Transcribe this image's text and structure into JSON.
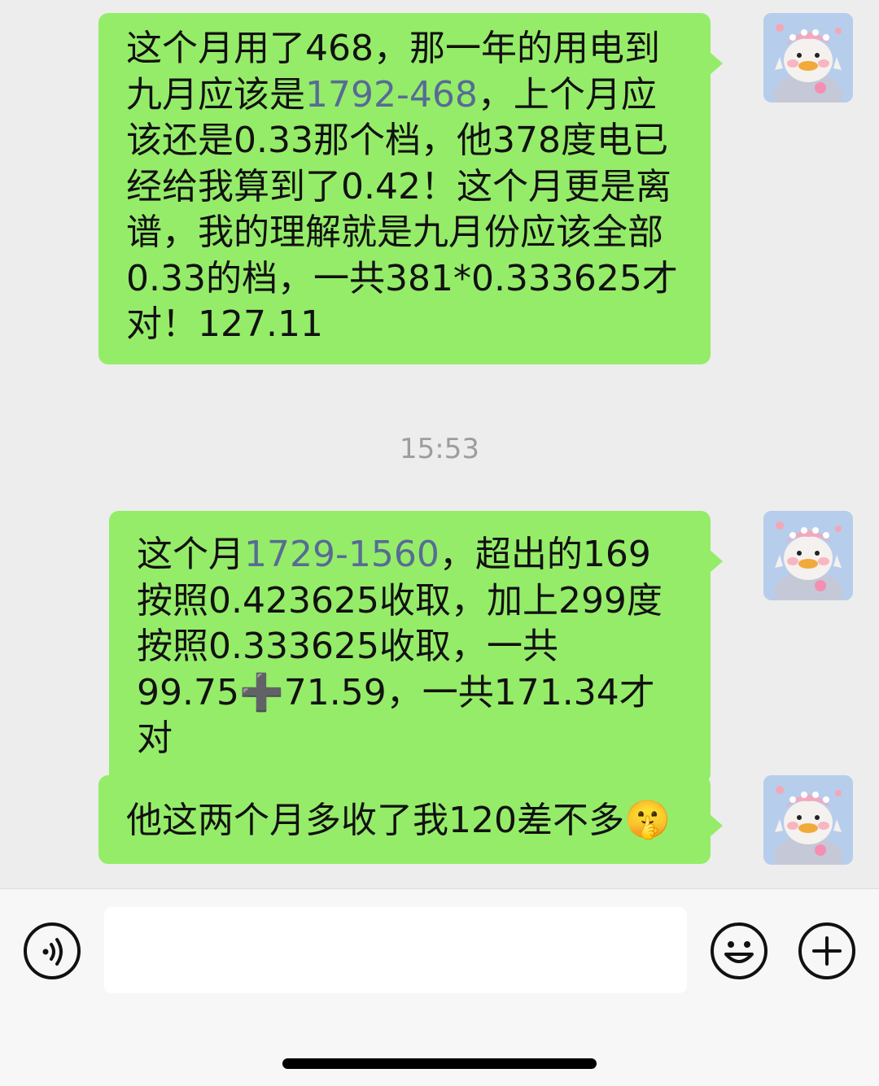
{
  "messages": [
    {
      "sender": "me",
      "parts": [
        {
          "text": "这个月用了468，那一年的用电到九月应该是"
        },
        {
          "text": "1792-468",
          "link": true
        },
        {
          "text": "，上个月应该还是0.33那个档，他378度电已经给我算到了0.42！这个月更是离谱，我的理解就是九月份应该全部0.33的档，一共381*0.333625才对！127.11"
        }
      ]
    },
    {
      "sender": "me",
      "parts": [
        {
          "text": "这个月"
        },
        {
          "text": "1729-1560",
          "link": true
        },
        {
          "text": "，超出的169按照0.423625收取，加上299度按照0.333625收取，一共99.75"
        },
        {
          "text": "➕",
          "icon": "heavy-plus-icon"
        },
        {
          "text": "71.59，一共171.34才对"
        }
      ]
    },
    {
      "sender": "me",
      "parts": [
        {
          "text": "他这两个月多收了我120差不多"
        },
        {
          "text": "🤫",
          "icon": "shushing-face-emoji"
        }
      ]
    }
  ],
  "timestamp": "15:53",
  "input_bar": {
    "value": "",
    "icons": [
      "voice-icon",
      "emoji-icon",
      "plus-icon"
    ]
  },
  "colors": {
    "background": "#ededed",
    "bubble": "#95ec69",
    "link": "#576b95",
    "timestamp": "#9d9d9d"
  }
}
